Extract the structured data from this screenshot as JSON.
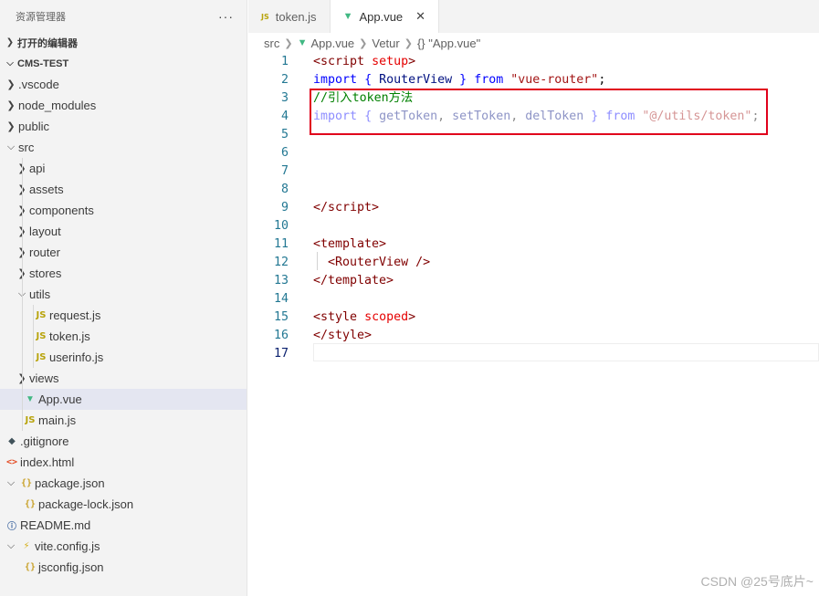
{
  "sidebar": {
    "title": "资源管理器",
    "more_label": "···",
    "open_editors": "打开的编辑器",
    "project": "CMS-TEST",
    "tree": [
      {
        "label": ".vscode",
        "type": "folder",
        "open": false,
        "depth": 1
      },
      {
        "label": "node_modules",
        "type": "folder",
        "open": false,
        "depth": 1
      },
      {
        "label": "public",
        "type": "folder",
        "open": false,
        "depth": 1
      },
      {
        "label": "src",
        "type": "folder",
        "open": true,
        "depth": 1
      },
      {
        "label": "api",
        "type": "folder",
        "open": false,
        "depth": 2
      },
      {
        "label": "assets",
        "type": "folder",
        "open": false,
        "depth": 2
      },
      {
        "label": "components",
        "type": "folder",
        "open": false,
        "depth": 2
      },
      {
        "label": "layout",
        "type": "folder",
        "open": false,
        "depth": 2
      },
      {
        "label": "router",
        "type": "folder",
        "open": false,
        "depth": 2
      },
      {
        "label": "stores",
        "type": "folder",
        "open": false,
        "depth": 2
      },
      {
        "label": "utils",
        "type": "folder",
        "open": true,
        "depth": 2
      },
      {
        "label": "request.js",
        "type": "js",
        "depth": 3
      },
      {
        "label": "token.js",
        "type": "js",
        "depth": 3
      },
      {
        "label": "userinfo.js",
        "type": "js",
        "depth": 3
      },
      {
        "label": "views",
        "type": "folder",
        "open": false,
        "depth": 2
      },
      {
        "label": "App.vue",
        "type": "vue",
        "depth": 2,
        "selected": true
      },
      {
        "label": "main.js",
        "type": "js",
        "depth": 2
      },
      {
        "label": ".gitignore",
        "type": "git",
        "depth": 1
      },
      {
        "label": "index.html",
        "type": "html",
        "depth": 1
      },
      {
        "label": "package.json",
        "type": "json",
        "open": true,
        "depth": 1,
        "twisty": true
      },
      {
        "label": "package-lock.json",
        "type": "json",
        "depth": 2
      },
      {
        "label": "README.md",
        "type": "info",
        "depth": 1
      },
      {
        "label": "vite.config.js",
        "type": "vite",
        "open": true,
        "depth": 1,
        "twisty": true
      },
      {
        "label": "jsconfig.json",
        "type": "json",
        "depth": 2
      }
    ]
  },
  "tabs": [
    {
      "label": "token.js",
      "icon": "JS",
      "active": false
    },
    {
      "label": "App.vue",
      "icon": "vue-icon",
      "active": true,
      "close": "✕"
    }
  ],
  "breadcrumb": [
    "src",
    "App.vue",
    "Vetur",
    "{} \"App.vue\""
  ],
  "code": {
    "line_numbers": [
      "1",
      "2",
      "3",
      "4",
      "5",
      "6",
      "7",
      "8",
      "9",
      "10",
      "11",
      "12",
      "13",
      "14",
      "15",
      "16",
      "17"
    ],
    "current_line": "17"
  },
  "watermark": "CSDN @25号底片~",
  "colors": {
    "highlight_box": "#e0001b",
    "selected_row": "#e4e6f1",
    "vue": "#41b883"
  }
}
